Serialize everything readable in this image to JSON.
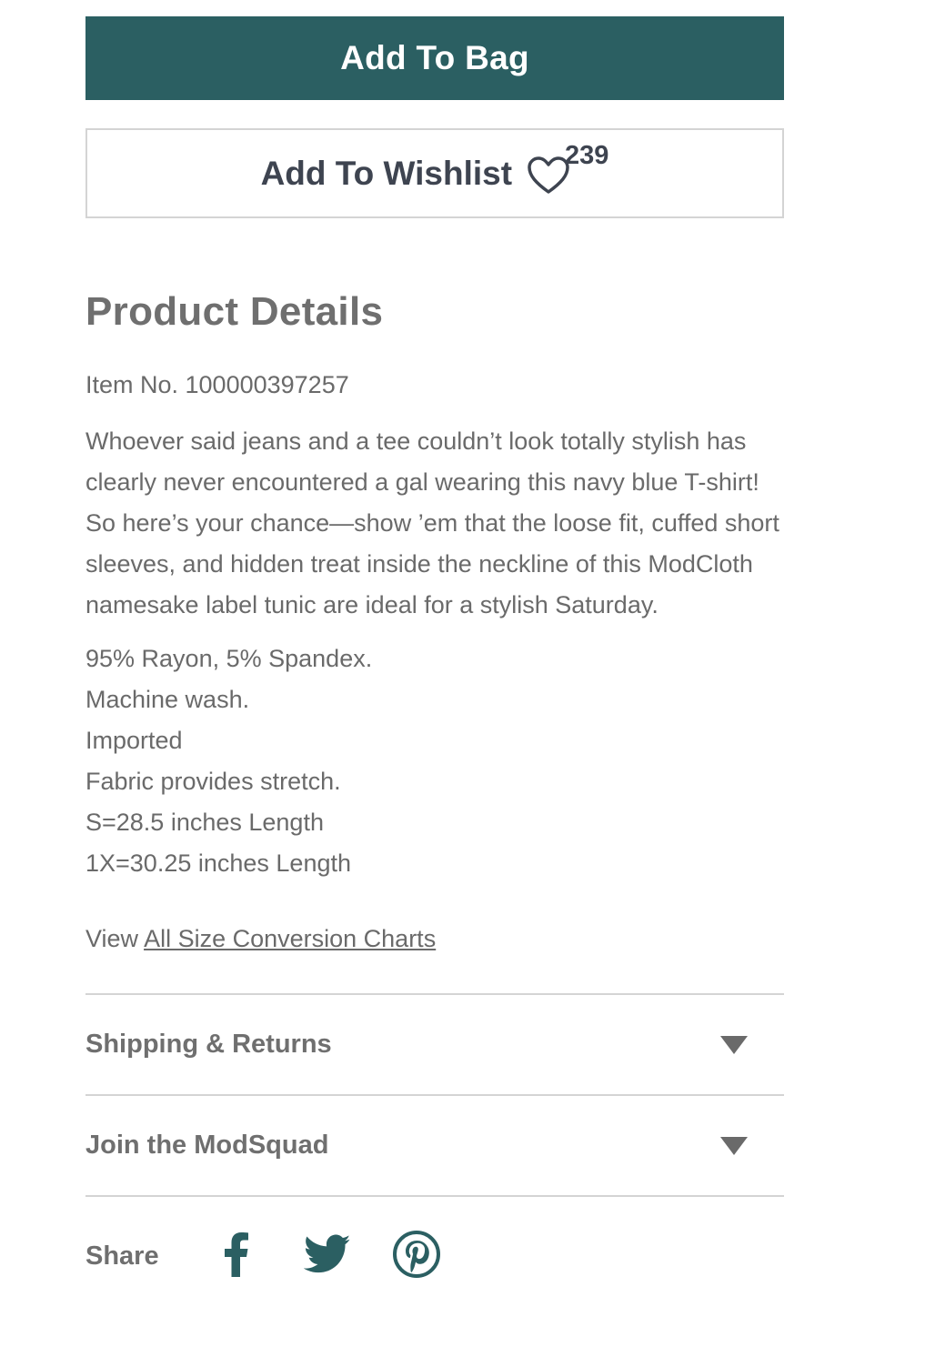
{
  "actions": {
    "add_to_bag_label": "Add To Bag",
    "add_to_wishlist_label": "Add To Wishlist",
    "wishlist_count": "239"
  },
  "product": {
    "section_title": "Product Details",
    "item_number": "Item No. 100000397257",
    "description": "Whoever said jeans and a tee couldn’t look totally stylish has clearly never encountered a gal wearing this navy blue T-shirt! So here’s your chance—show ’em that the loose fit, cuffed short sleeves, and hidden treat inside the neckline of this ModCloth namesake label tunic are ideal for a stylish Saturday.",
    "facts": [
      "95% Rayon, 5% Spandex.",
      "Machine wash.",
      "Imported",
      "Fabric provides stretch.",
      "S=28.5 inches Length",
      "1X=30.25 inches Length"
    ],
    "size_chart_prefix": "View",
    "size_chart_link": "All Size Conversion Charts"
  },
  "accordion": [
    {
      "label": "Shipping & Returns",
      "icon": "triangle-down-icon"
    },
    {
      "label": "Join the ModSquad",
      "icon": "triangle-down-icon"
    }
  ],
  "share": {
    "label": "Share",
    "icons": [
      "facebook-icon",
      "twitter-icon",
      "pinterest-icon"
    ]
  },
  "colors": {
    "primary": "#2b5f62",
    "heading": "#6f6f6f",
    "text": "#6a6a6a",
    "dark_text": "#3e4450",
    "border": "#d4d4d4"
  }
}
